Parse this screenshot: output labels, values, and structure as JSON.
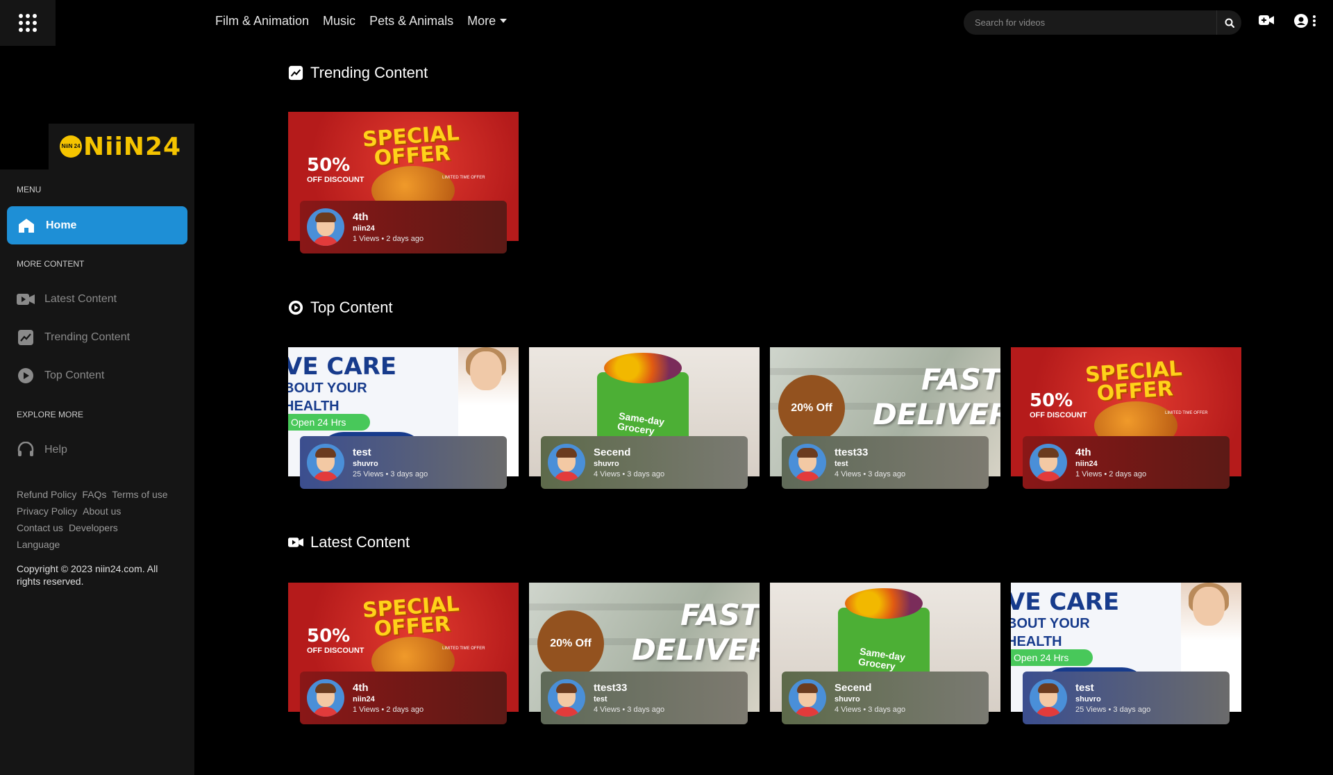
{
  "topnav": {
    "categories": [
      "Film & Animation",
      "Music",
      "Pets & Animals"
    ],
    "more_label": "More",
    "search_placeholder": "Search for videos"
  },
  "brand": {
    "logo_text": "NiiN24",
    "coin_text": "NiiN 24",
    "color": "#f5c400"
  },
  "sidebar": {
    "menu_header": "MENU",
    "home_label": "Home",
    "more_content_header": "MORE CONTENT",
    "more_items": [
      "Latest Content",
      "Trending Content",
      "Top Content"
    ],
    "explore_header": "EXPLORE MORE",
    "help_label": "Help",
    "links": [
      "Refund Policy",
      "FAQs",
      "Terms of use",
      "Privacy Policy",
      "About us",
      "Contact us",
      "Developers",
      "Language"
    ],
    "copyright": "Copyright © 2023 niin24.com. All rights reserved.",
    "active_color": "#1e8fd6"
  },
  "sections": {
    "trending": {
      "title": "Trending Content",
      "cards": [
        {
          "title": "4th",
          "author": "niin24",
          "stats": "1 Views • 2 days ago"
        }
      ]
    },
    "top": {
      "title": "Top Content",
      "cards": [
        {
          "title": "test",
          "author": "shuvro",
          "stats": "25 Views • 3 days ago"
        },
        {
          "title": "Secend",
          "author": "shuvro",
          "stats": "4 Views • 3 days ago"
        },
        {
          "title": "ttest33",
          "author": "test",
          "stats": "4 Views • 3 days ago"
        },
        {
          "title": "4th",
          "author": "niin24",
          "stats": "1 Views • 2 days ago"
        }
      ]
    },
    "latest": {
      "title": "Latest Content",
      "cards": [
        {
          "title": "4th",
          "author": "niin24",
          "stats": "1 Views • 2 days ago"
        },
        {
          "title": "ttest33",
          "author": "test",
          "stats": "4 Views • 3 days ago"
        },
        {
          "title": "Secend",
          "author": "shuvro",
          "stats": "4 Views • 3 days ago"
        },
        {
          "title": "test",
          "author": "shuvro",
          "stats": "25 Views • 3 days ago"
        }
      ]
    }
  },
  "thumbs": {
    "offer": {
      "line1": "SPECIAL",
      "line2": "OFFER",
      "pct": "50%",
      "sub": "OFF DISCOUNT",
      "tag": "LIMITED TIME OFFER"
    },
    "care": {
      "line1": "VE CARE",
      "line2": "BOUT YOUR",
      "line3": "HEALTH",
      "open": "Open 24 Hrs"
    },
    "grocery": {
      "line1": "Same-day",
      "line2": "Grocery"
    },
    "fast": {
      "badge": "20% Off",
      "line1": "FAST",
      "line2": "DELIVERY"
    }
  }
}
